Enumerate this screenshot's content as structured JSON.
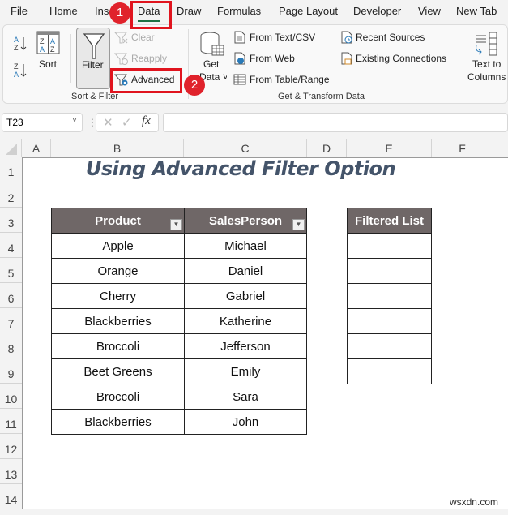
{
  "menu_tabs": [
    "File",
    "Home",
    "Insert",
    "Data",
    "Draw",
    "Formulas",
    "Page Layout",
    "Developer",
    "View",
    "New Tab"
  ],
  "active_tab": "Data",
  "ribbon": {
    "sort_filter": {
      "sort_label": "Sort",
      "filter_label": "Filter",
      "clear_label": "Clear",
      "reapply_label": "Reapply",
      "advanced_label": "Advanced",
      "group_label": "Sort & Filter"
    },
    "get_transform": {
      "get_data_label_1": "Get",
      "get_data_label_2": "Data",
      "from_text_csv": "From Text/CSV",
      "from_web": "From Web",
      "from_table_range": "From Table/Range",
      "recent_sources": "Recent Sources",
      "existing_connections": "Existing Connections",
      "group_label": "Get & Transform Data"
    },
    "text_to_columns_1": "Text to",
    "text_to_columns_2": "Columns"
  },
  "annotations": {
    "step1": "1",
    "step2": "2"
  },
  "formula_bar": {
    "name_box": "T23",
    "fx_label": "fx",
    "formula": ""
  },
  "columns": [
    "A",
    "B",
    "C",
    "D",
    "E",
    "F"
  ],
  "rows": [
    "1",
    "2",
    "3",
    "4",
    "5",
    "6",
    "7",
    "8",
    "9",
    "10",
    "11",
    "12",
    "13",
    "14"
  ],
  "sheet": {
    "title": "Using Advanced Filter Option",
    "headers": [
      "Product",
      "SalesPerson"
    ],
    "data": [
      [
        "Apple",
        "Michael"
      ],
      [
        "Orange",
        "Daniel"
      ],
      [
        "Cherry",
        "Gabriel"
      ],
      [
        "Blackberries",
        "Katherine"
      ],
      [
        "Broccoli",
        "Jefferson"
      ],
      [
        "Beet Greens",
        "Emily"
      ],
      [
        "Broccoli",
        "Sara"
      ],
      [
        "Blackberries",
        "John"
      ]
    ],
    "filtered_header": "Filtered List"
  },
  "watermark": "wsxdn.com",
  "colors": {
    "accent_red": "#e0141e",
    "header_fill": "#6f6767",
    "title_color": "#44546a",
    "active_tab_underline": "#1e7145"
  }
}
